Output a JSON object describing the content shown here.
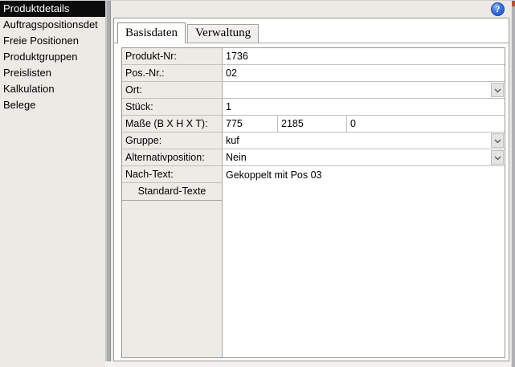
{
  "window": {
    "help_icon_glyph": "?"
  },
  "sidebar": {
    "items": [
      {
        "label": "Produktdetails",
        "selected": true
      },
      {
        "label": "Auftragspositionsdet",
        "selected": false
      },
      {
        "label": "Freie Positionen",
        "selected": false
      },
      {
        "label": "Produktgruppen",
        "selected": false
      },
      {
        "label": "Preislisten",
        "selected": false
      },
      {
        "label": "Kalkulation",
        "selected": false
      },
      {
        "label": "Belege",
        "selected": false
      }
    ]
  },
  "tabs": [
    {
      "label": "Basisdaten",
      "active": true
    },
    {
      "label": "Verwaltung",
      "active": false
    }
  ],
  "form": {
    "rows": [
      {
        "label": "Produkt-Nr:",
        "value": "1736",
        "type": "text"
      },
      {
        "label": "Pos.-Nr.:",
        "value": "02",
        "type": "text"
      },
      {
        "label": "Ort:",
        "value": "",
        "type": "dropdown"
      },
      {
        "label": "Stück:",
        "value": "1",
        "type": "text"
      },
      {
        "label": "Maße (B X H X T):",
        "values": [
          "775",
          "2185",
          "0"
        ],
        "type": "triple"
      },
      {
        "label": "Gruppe:",
        "value": "kuf",
        "type": "dropdown"
      },
      {
        "label": "Alternativposition:",
        "value": "Nein",
        "type": "dropdown"
      },
      {
        "label": "Nach-Text:",
        "value": "Gekoppelt mit Pos 03",
        "type": "textarea"
      }
    ],
    "standard_texts_button": "Standard-Texte"
  },
  "colors": {
    "selected_item_bg": "#0b0b0b",
    "help_icon_blue": "#2b5fce",
    "close_button_red": "#cd4339",
    "label_cell_bg": "#edebe6",
    "window_bg": "#edeae6"
  }
}
